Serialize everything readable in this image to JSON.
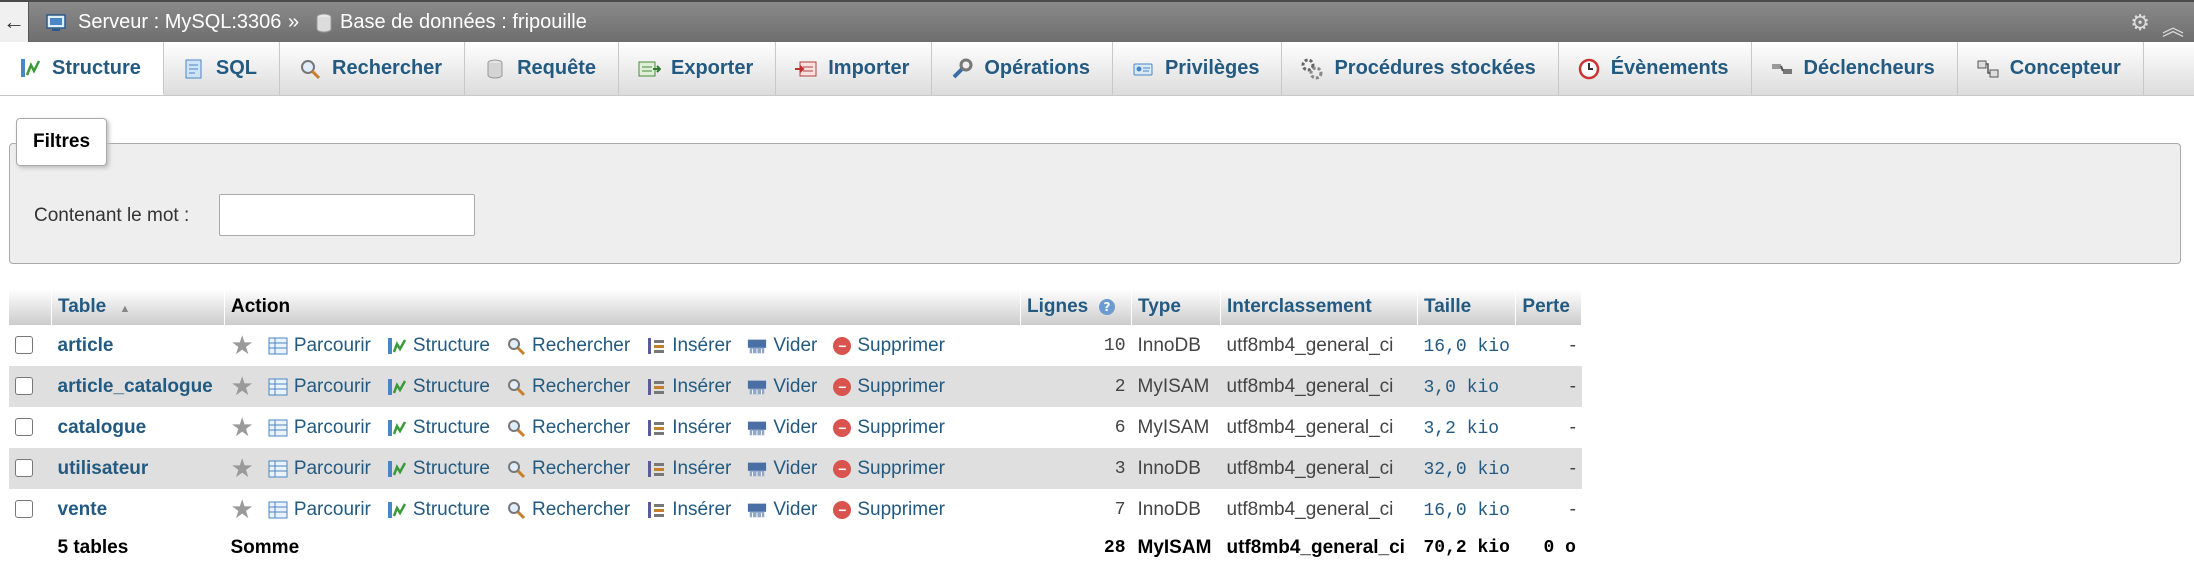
{
  "breadcrumb": {
    "back_glyph": "←",
    "server": "Serveur : MySQL:3306",
    "separator": "»",
    "database": "Base de données : fripouille"
  },
  "tabs": [
    {
      "label": "Structure",
      "icon": "structure-icon",
      "active": true
    },
    {
      "label": "SQL",
      "icon": "sql-icon"
    },
    {
      "label": "Rechercher",
      "icon": "search-icon"
    },
    {
      "label": "Requête",
      "icon": "query-icon"
    },
    {
      "label": "Exporter",
      "icon": "export-icon"
    },
    {
      "label": "Importer",
      "icon": "import-icon"
    },
    {
      "label": "Opérations",
      "icon": "wrench-icon"
    },
    {
      "label": "Privilèges",
      "icon": "privileges-icon"
    },
    {
      "label": "Procédures stockées",
      "icon": "routines-icon"
    },
    {
      "label": "Évènements",
      "icon": "events-icon"
    },
    {
      "label": "Déclencheurs",
      "icon": "triggers-icon"
    },
    {
      "label": "Concepteur",
      "icon": "designer-icon"
    }
  ],
  "filters": {
    "legend": "Filtres",
    "label": "Contenant le mot :",
    "value": "",
    "placeholder": ""
  },
  "table": {
    "headers": {
      "table": "Table",
      "sort_glyph": "▲",
      "action": "Action",
      "rows": "Lignes",
      "type": "Type",
      "collation": "Interclassement",
      "size": "Taille",
      "overhead": "Perte"
    },
    "action_labels": {
      "browse": "Parcourir",
      "structure": "Structure",
      "search": "Rechercher",
      "insert": "Insérer",
      "empty": "Vider",
      "drop": "Supprimer"
    },
    "rows": [
      {
        "name": "article",
        "rows": "10",
        "type": "InnoDB",
        "collation": "utf8mb4_general_ci",
        "size": "16,0 kio",
        "overhead": "-"
      },
      {
        "name": "article_catalogue",
        "rows": "2",
        "type": "MyISAM",
        "collation": "utf8mb4_general_ci",
        "size": "3,0 kio",
        "overhead": "-"
      },
      {
        "name": "catalogue",
        "rows": "6",
        "type": "MyISAM",
        "collation": "utf8mb4_general_ci",
        "size": "3,2 kio",
        "overhead": "-"
      },
      {
        "name": "utilisateur",
        "rows": "3",
        "type": "InnoDB",
        "collation": "utf8mb4_general_ci",
        "size": "32,0 kio",
        "overhead": "-"
      },
      {
        "name": "vente",
        "rows": "7",
        "type": "InnoDB",
        "collation": "utf8mb4_general_ci",
        "size": "16,0 kio",
        "overhead": "-"
      }
    ],
    "footer": {
      "count": "5 tables",
      "label": "Somme",
      "rows": "28",
      "type": "MyISAM",
      "collation": "utf8mb4_general_ci",
      "size": "70,2 kio",
      "overhead": "0 o"
    }
  },
  "colors": {
    "link": "#235a81",
    "drop": "#d9534f",
    "topbar": "#777777"
  }
}
